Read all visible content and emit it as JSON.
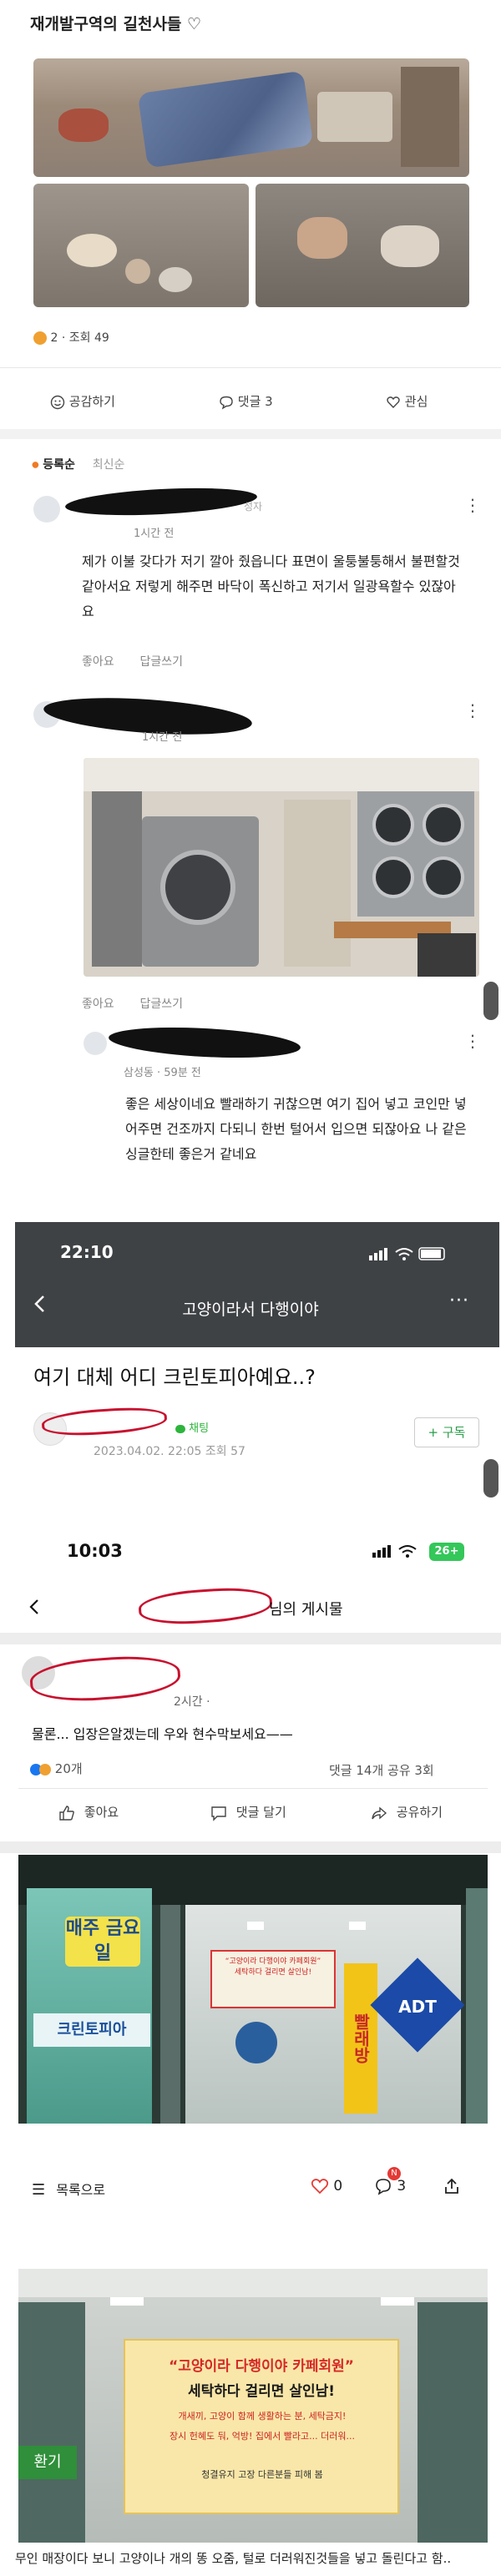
{
  "post": {
    "title": "재개발구역의 길천사들 ♡",
    "like_count": "2",
    "views": "· 조회 49",
    "actions": {
      "like": "공감하기",
      "comment": "댓글 3",
      "interest": "관심"
    }
  },
  "comments_header": {
    "sort_registered": "등록순",
    "sort_latest": "최신순"
  },
  "comments": [
    {
      "badge": "성자",
      "time": "1시간 전",
      "text": "제가 이불 갖다가 저기 깔아 줬읍니다 표면이 울퉁불퉁해서 불편할것 같아서요 저렇게 해주면 바닥이 폭신하고 저기서 일광욕할수 있잖아요",
      "like": "좋아요",
      "reply": "답글쓰기"
    },
    {
      "time": "1시간 전",
      "like": "좋아요",
      "reply": "답글쓰기"
    },
    {
      "location": "삼성동 · 59분 전",
      "text": "좋은 세상이네요 빨래하기 귀찮으면 여기 집어 넣고 코인만 넣어주면 건조까지 다되니 한번 털어서 입으면 되잖아요 나 같은 싱글한테 좋은거 같네요"
    }
  ],
  "shot1": {
    "time": "22:10",
    "nav_title": "고양이라서 다행이야",
    "post_title": "여기 대체 어디 크린토피아예요..?",
    "chat_label": "채팅",
    "meta": "2023.04.02. 22:05 조회 57",
    "subscribe": "+ 구독"
  },
  "shot2": {
    "time": "10:03",
    "battery": "26+",
    "nav_title_suffix": "님의 게시물",
    "post_time": "2시간 ·",
    "post_text": "물론... 입장은알겠는데 우와 현수막보세요——",
    "reactions": "20개",
    "comments_shares": "댓글 14개  공유 3회",
    "actions": {
      "like": "좋아요",
      "comment": "댓글 달기",
      "share": "공유하기"
    },
    "toolbar": {
      "back_list": "목록으로",
      "likes": "0",
      "comments": "3",
      "notif": "N"
    }
  },
  "banner": {
    "line1": "“고양이라 다행이야 카페회원”",
    "line2": "세탁하다 걸리면 살인남!",
    "small1": "개새끼, 고양이 함께 생활하는 분, 세탁금지!",
    "small2": "장시 헌혜도 둬, 억방! 집에서 빨라고... 더러워...",
    "small3": "청결유지 고장 다른분들 피해 봄",
    "store_sign": "크린토피아",
    "store_sign2": "매주 금요일",
    "ad_sign": "ADT",
    "cleaning_sign": "빨래방",
    "green_label": "환기"
  },
  "caption": "무인 매장이다 보니 고양이나 개의 똥 오줌, 털로 더러워진것들을 넣고 돌린다고 함.."
}
